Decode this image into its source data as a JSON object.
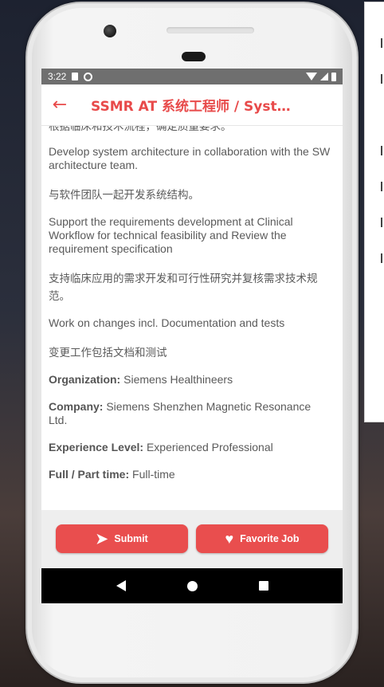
{
  "status_bar": {
    "time": "3:22",
    "icons": [
      "sd-card-icon",
      "sync-icon",
      "wifi-icon",
      "signal-icon",
      "battery-icon"
    ]
  },
  "app_bar": {
    "back_icon": "arrow-left-icon",
    "title": "SSMR AT 系统工程师 / System Engineer"
  },
  "job_detail": {
    "partial_top_line": "根据临床和技术流程，确定质量要求。",
    "paragraphs": [
      {
        "text": "Develop system architecture in collaboration with the SW architecture team.",
        "lang": "en"
      },
      {
        "text": "与软件团队一起开发系统结构。",
        "lang": "zh"
      },
      {
        "text": "Support the requirements development at Clinical Workflow for technical feasibility and Review the requirement specification",
        "lang": "en"
      },
      {
        "text": "支持临床应用的需求开发和可行性研究并复核需求技术规范。",
        "lang": "zh"
      },
      {
        "text": "Work on changes incl. Documentation and tests",
        "lang": "en"
      },
      {
        "text": "变更工作包括文档和测试",
        "lang": "zh"
      }
    ],
    "fields": [
      {
        "label": "Organization:",
        "value": " Siemens Healthineers"
      },
      {
        "label": "Company:",
        "value": " Siemens Shenzhen Magnetic Resonance Ltd."
      },
      {
        "label": "Experience Level:",
        "value": " Experienced Professional"
      },
      {
        "label": "Full / Part time:",
        "value": " Full-time"
      }
    ]
  },
  "actions": {
    "submit_label": "Submit",
    "submit_icon": "send-icon",
    "favorite_label": "Favorite Job",
    "favorite_icon": "heart-icon"
  },
  "colors": {
    "accent": "#e94e4e",
    "status_bar": "#6f6f6f",
    "text": "#5a5a5a"
  }
}
